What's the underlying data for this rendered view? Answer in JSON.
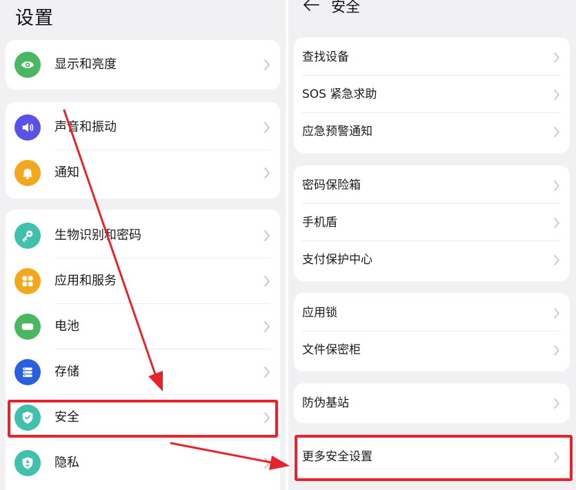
{
  "left": {
    "title": "设置",
    "groups": [
      {
        "items": [
          {
            "label": "显示和亮度",
            "icon": "eye-icon",
            "color": "#4cb763"
          }
        ]
      },
      {
        "items": [
          {
            "label": "声音和振动",
            "icon": "speaker-icon",
            "color": "#5a52e6"
          },
          {
            "label": "通知",
            "icon": "bell-icon",
            "color": "#f2a81c"
          }
        ]
      },
      {
        "items": [
          {
            "label": "生物识别和密码",
            "icon": "key-icon",
            "color": "#40c0ad"
          },
          {
            "label": "应用和服务",
            "icon": "apps-grid-icon",
            "color": "#f2a81c"
          },
          {
            "label": "电池",
            "icon": "battery-icon",
            "color": "#4cb763"
          },
          {
            "label": "存储",
            "icon": "storage-icon",
            "color": "#2a5fe0"
          },
          {
            "label": "安全",
            "icon": "shield-icon",
            "color": "#40c0ad"
          },
          {
            "label": "隐私",
            "icon": "privacy-shield-icon",
            "color": "#40c0ad"
          }
        ]
      }
    ]
  },
  "right": {
    "title": "安全",
    "groups": [
      {
        "items": [
          {
            "label": "查找设备"
          },
          {
            "label": "SOS 紧急求助"
          },
          {
            "label": "应急预警通知"
          }
        ]
      },
      {
        "items": [
          {
            "label": "密码保险箱"
          },
          {
            "label": "手机盾"
          },
          {
            "label": "支付保护中心"
          }
        ]
      },
      {
        "items": [
          {
            "label": "应用锁"
          },
          {
            "label": "文件保密柜"
          }
        ]
      },
      {
        "items": [
          {
            "label": "防伪基站"
          }
        ]
      },
      {
        "items": [
          {
            "label": "更多安全设置"
          }
        ]
      }
    ]
  },
  "colors": {
    "highlight": "#e8222a",
    "background": "#f1f1f3",
    "card": "#ffffff"
  }
}
